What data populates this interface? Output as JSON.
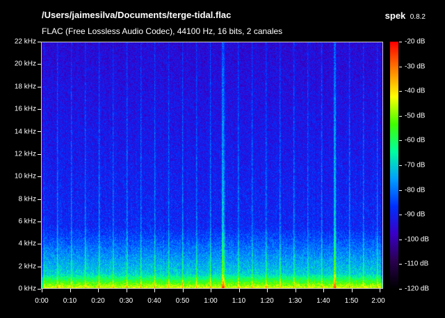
{
  "header": {
    "file_path": "/Users/jaimesilva/Documents/terge-tidal.flac",
    "file_info": "FLAC (Free Lossless Audio Codec), 44100 Hz, 16 bits, 2 canales",
    "app_name": "spek",
    "app_version": "0.8.2"
  },
  "frequency_axis": {
    "labels": [
      "22 kHz",
      "20 kHz",
      "18 kHz",
      "16 kHz",
      "14 kHz",
      "12 kHz",
      "10 kHz",
      "8 kHz",
      "6 kHz",
      "4 kHz",
      "2 kHz",
      "0 kHz"
    ]
  },
  "time_axis": {
    "labels": [
      "0:00",
      "0:10",
      "0:20",
      "0:30",
      "0:40",
      "0:50",
      "1:00",
      "1:10",
      "1:20",
      "1:30",
      "1:40",
      "1:50",
      "2:00"
    ]
  },
  "level_scale": {
    "labels": [
      "-20 dB",
      "-30 dB",
      "-40 dB",
      "-50 dB",
      "-60 dB",
      "-70 dB",
      "-80 dB",
      "-90 dB",
      "-100 dB",
      "-110 dB",
      "-120 dB"
    ]
  },
  "colors": {
    "background": "#000000",
    "text": "#ffffff",
    "gradient": [
      "#000000",
      "#2a0050",
      "#3a00c8",
      "#0030ff",
      "#00a0ff",
      "#00ffa0",
      "#40ff00",
      "#ffff00",
      "#ff8000",
      "#ff0000"
    ]
  }
}
